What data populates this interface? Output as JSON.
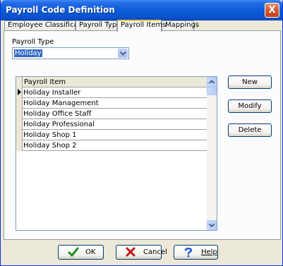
{
  "window": {
    "title": "Payroll Code Definition",
    "close_glyph": "X"
  },
  "tabs": [
    {
      "label": "Employee Classification"
    },
    {
      "label": "Payroll Type"
    },
    {
      "label": "Payroll Items",
      "active": true
    },
    {
      "label": "Mappings"
    }
  ],
  "payroll_type": {
    "label": "Payroll Type",
    "selected": "Holiday"
  },
  "grid": {
    "header": "Payroll Item",
    "rows": [
      "Holiday Installer",
      "Holiday Management",
      "Holiday Office Staff",
      "Holiday Professional",
      "Holiday Shop 1",
      "Holiday Shop 2"
    ],
    "current_row_icon": "row-pointer-icon"
  },
  "side_buttons": {
    "new": "New",
    "modify": "Modify",
    "delete": "Delete"
  },
  "footer_buttons": {
    "ok": {
      "label": "OK",
      "icon": "checkmark-icon"
    },
    "cancel": {
      "label": "Cancel",
      "icon": "x-icon"
    },
    "help": {
      "label": "Help",
      "icon": "question-icon"
    }
  },
  "colors": {
    "titlebar": "#0a5bd8",
    "dialog_bg": "#ece9d8",
    "selection": "#316ac5",
    "ok_icon": "#1a8a1a",
    "cancel_icon": "#c01818",
    "help_icon": "#1e5ad6"
  }
}
